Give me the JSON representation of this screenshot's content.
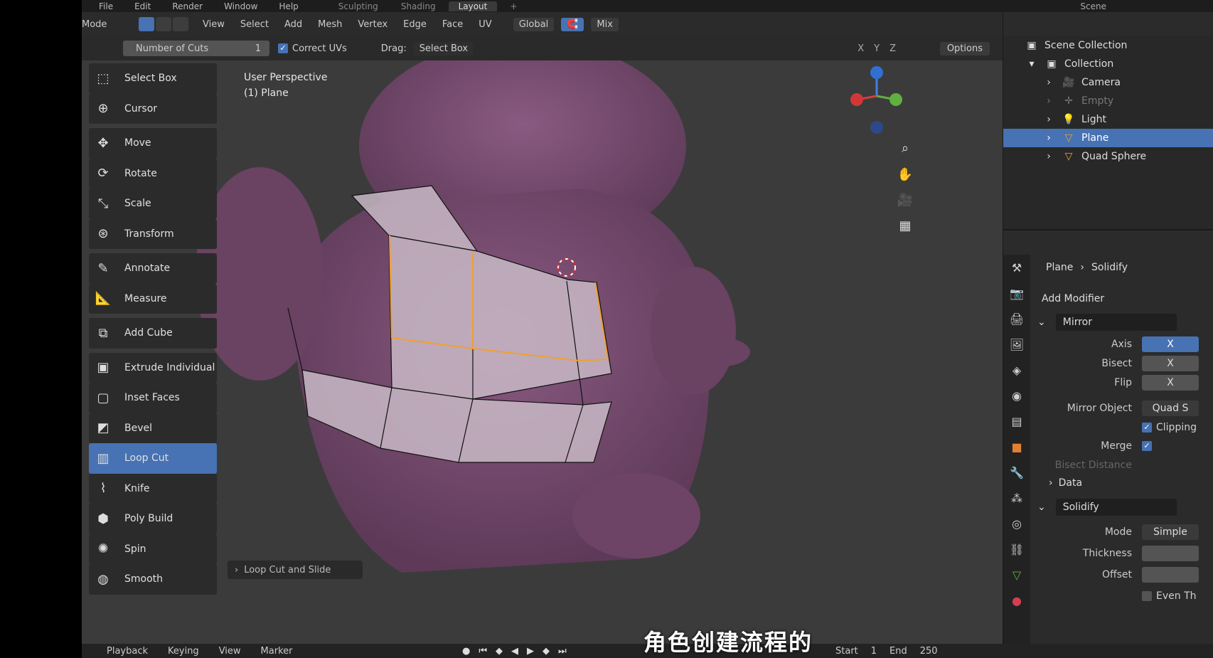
{
  "topbar": {
    "menu": [
      "File",
      "Edit",
      "Render",
      "Window",
      "Help"
    ],
    "workspaces": [
      "Sculpting",
      "Shading",
      "Layout"
    ],
    "active_workspace": "Layout",
    "add_workspace": "+",
    "scene": "Scene"
  },
  "header": {
    "mode": "Mode",
    "menu": [
      "View",
      "Select",
      "Add",
      "Mesh",
      "Vertex",
      "Edge",
      "Face",
      "UV"
    ],
    "orientation": "Global",
    "snap_mode": "Mix"
  },
  "tool_settings": {
    "cuts_label": "Number of Cuts",
    "cuts_value": "1",
    "correct_uvs": "Correct UVs",
    "drag_label": "Drag:",
    "drag_value": "Select Box",
    "axes": [
      "X",
      "Y",
      "Z"
    ],
    "options": "Options"
  },
  "viewport": {
    "perspective": "User Perspective",
    "object": "(1) Plane",
    "operator_panel": "Loop Cut and Slide"
  },
  "tools": [
    {
      "label": "Select Box",
      "icon": "select-box-icon",
      "glyph": "⬚"
    },
    {
      "label": "Cursor",
      "icon": "cursor-icon",
      "glyph": "⊕"
    },
    {
      "label": "Move",
      "icon": "move-icon",
      "glyph": "✥"
    },
    {
      "label": "Rotate",
      "icon": "rotate-icon",
      "glyph": "⟳"
    },
    {
      "label": "Scale",
      "icon": "scale-icon",
      "glyph": "⤡"
    },
    {
      "label": "Transform",
      "icon": "transform-icon",
      "glyph": "⊛"
    },
    {
      "label": "Annotate",
      "icon": "annotate-icon",
      "glyph": "✎"
    },
    {
      "label": "Measure",
      "icon": "measure-icon",
      "glyph": "📐"
    },
    {
      "label": "Add Cube",
      "icon": "add-cube-icon",
      "glyph": "⧉"
    },
    {
      "label": "Extrude Individual",
      "icon": "extrude-icon",
      "glyph": "▣"
    },
    {
      "label": "Inset Faces",
      "icon": "inset-faces-icon",
      "glyph": "▢"
    },
    {
      "label": "Bevel",
      "icon": "bevel-icon",
      "glyph": "◩"
    },
    {
      "label": "Loop Cut",
      "icon": "loop-cut-icon",
      "glyph": "▥"
    },
    {
      "label": "Knife",
      "icon": "knife-icon",
      "glyph": "⌇"
    },
    {
      "label": "Poly Build",
      "icon": "poly-build-icon",
      "glyph": "⬢"
    },
    {
      "label": "Spin",
      "icon": "spin-icon",
      "glyph": "✺"
    },
    {
      "label": "Smooth",
      "icon": "smooth-icon",
      "glyph": "◍"
    }
  ],
  "active_tool": "Loop Cut",
  "outliner": {
    "root": "Scene Collection",
    "collection": "Collection",
    "items": [
      {
        "label": "Camera",
        "icon": "camera-icon",
        "glyph": "🎥",
        "color": "#e39a5a"
      },
      {
        "label": "Empty",
        "icon": "empty-icon",
        "glyph": "✛",
        "color": "#e39a5a"
      },
      {
        "label": "Light",
        "icon": "light-icon",
        "glyph": "💡",
        "color": "#e3b85a"
      },
      {
        "label": "Plane",
        "icon": "mesh-icon",
        "glyph": "▽",
        "color": "#e39a5a"
      },
      {
        "label": "Quad Sphere",
        "icon": "mesh-icon",
        "glyph": "▽",
        "color": "#e39a5a"
      }
    ]
  },
  "properties": {
    "object": "Plane",
    "modifier_tab": "Solidify",
    "add_modifier": "Add Modifier",
    "mirror": {
      "name": "Mirror",
      "axis_label": "Axis",
      "axis_value": "X",
      "bisect_label": "Bisect",
      "bisect_value": "X",
      "flip_label": "Flip",
      "flip_value": "X",
      "mirror_object_label": "Mirror Object",
      "mirror_object_value": "Quad S",
      "clipping": "Clipping",
      "merge_label": "Merge",
      "bisect_distance": "Bisect Distance",
      "data": "Data"
    },
    "solidify": {
      "name": "Solidify",
      "mode_label": "Mode",
      "mode_value": "Simple",
      "thickness_label": "Thickness",
      "offset_label": "Offset",
      "even_label": "Even Th"
    }
  },
  "timeline": {
    "menu": [
      "Playback",
      "Keying",
      "View",
      "Marker"
    ],
    "start_label": "Start",
    "start_value": "1",
    "end_label": "End",
    "end_value": "250"
  },
  "subtitle": "角色创建流程的",
  "colors": {
    "accent": "#4772b3",
    "mesh": "#c8b8c6",
    "edge_selected": "#f0a030",
    "character": "#7a4a72"
  }
}
